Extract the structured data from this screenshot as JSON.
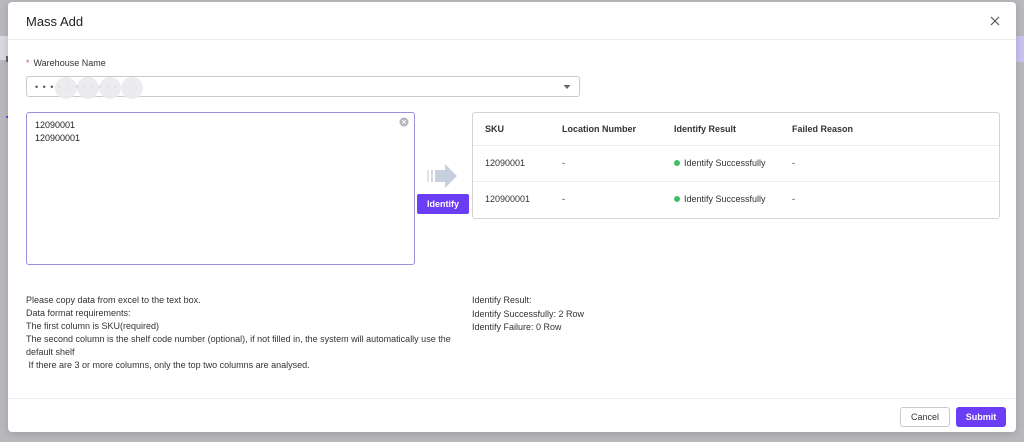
{
  "modal": {
    "title": "Mass Add"
  },
  "warehouse": {
    "required_mark": "*",
    "label": "Warehouse Name",
    "value": "• • • • 2-• • • • • •"
  },
  "input": {
    "text": "12090001\n120900001"
  },
  "identify_button": "Identify",
  "results": {
    "columns": [
      "SKU",
      "Location Number",
      "Identify Result",
      "Failed Reason"
    ],
    "rows": [
      {
        "sku": "12090001",
        "location": "-",
        "result": "Identify Successfully",
        "reason": "-"
      },
      {
        "sku": "120900001",
        "location": "-",
        "result": "Identify Successfully",
        "reason": "-"
      }
    ]
  },
  "instructions": [
    "Please copy data from excel to the text box.",
    "Data format requirements:",
    "The first column is SKU(required)",
    "The second column is the shelf code number (optional), if not filled in, the system will automatically use the default shelf",
    " If there are 3 or more columns, only the top two columns are analysed."
  ],
  "summary": {
    "heading": "Identify Result:",
    "success": "Identify Successfully: 2 Row",
    "failure": "Identify Failure: 0 Row"
  },
  "footer": {
    "cancel": "Cancel",
    "submit": "Submit"
  },
  "colors": {
    "accent": "#6b3df5",
    "success": "#3fbf6a",
    "required": "#e5484d"
  }
}
